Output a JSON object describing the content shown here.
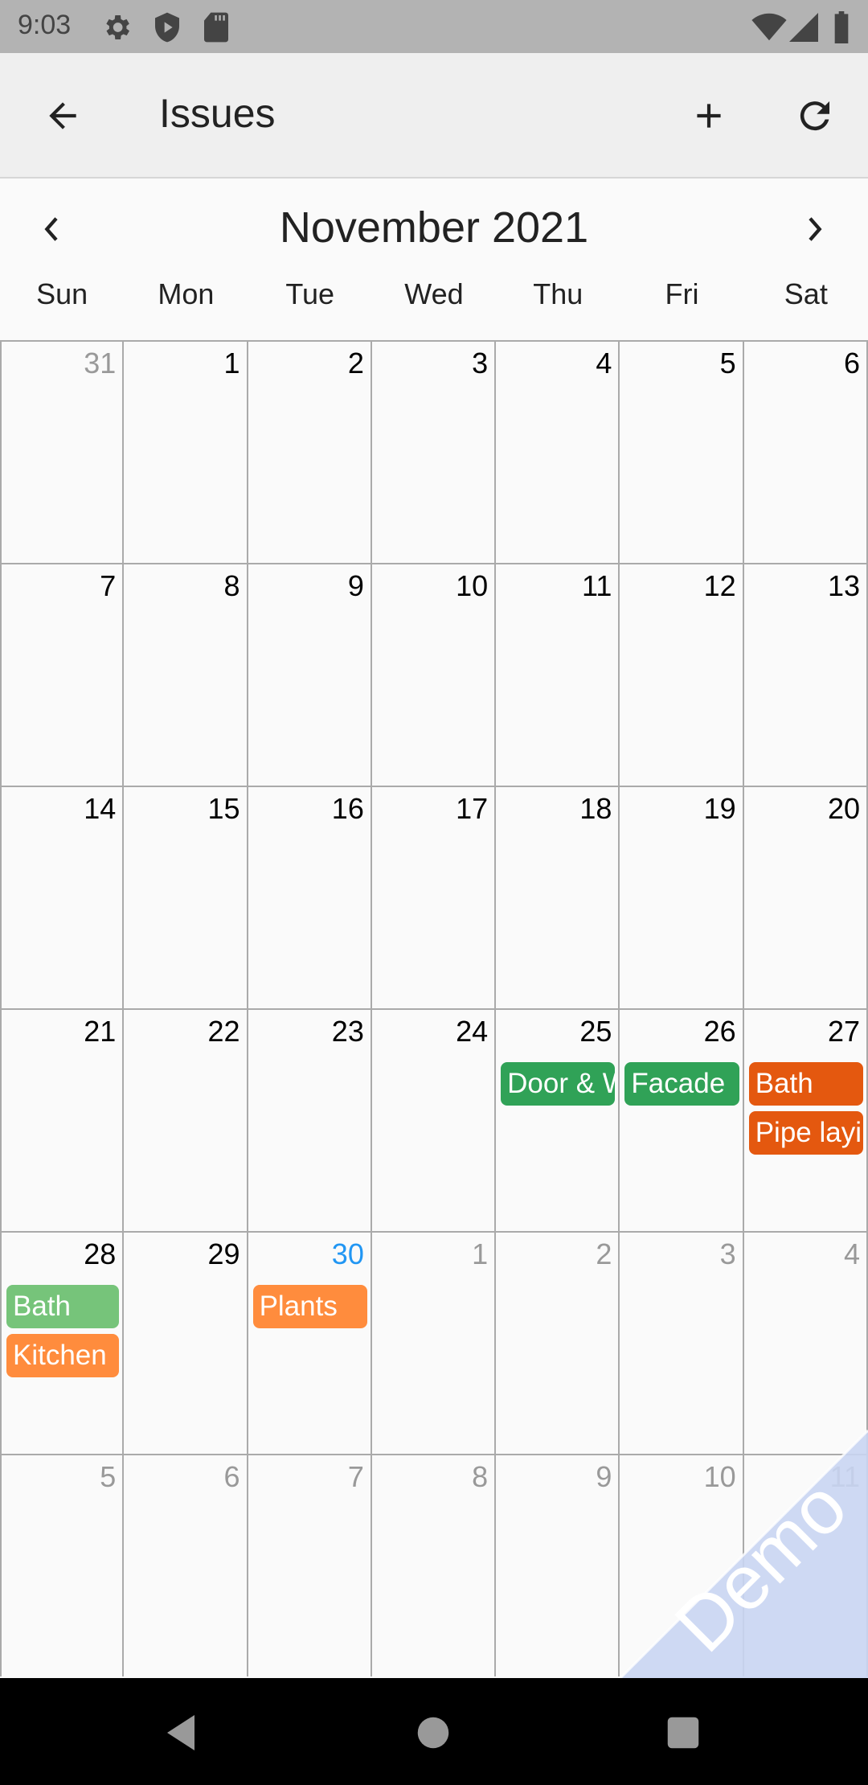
{
  "status_bar": {
    "time": "9:03",
    "left_icons": [
      "settings-icon",
      "shield-play-icon",
      "sd-card-icon"
    ],
    "right_icons": [
      "wifi-icon",
      "signal-icon",
      "battery-icon"
    ]
  },
  "app_bar": {
    "title": "Issues",
    "back_icon": "arrow-back-icon",
    "actions": [
      "add-icon",
      "refresh-icon"
    ]
  },
  "calendar": {
    "month_title": "November 2021",
    "prev_icon": "chevron-left-icon",
    "next_icon": "chevron-right-icon",
    "weekdays": [
      "Sun",
      "Mon",
      "Tue",
      "Wed",
      "Thu",
      "Fri",
      "Sat"
    ],
    "today": "30",
    "colors": {
      "today": "#2196f3",
      "other_month": "#999999"
    },
    "weeks": [
      [
        {
          "d": "31",
          "other": true
        },
        {
          "d": "1"
        },
        {
          "d": "2"
        },
        {
          "d": "3"
        },
        {
          "d": "4"
        },
        {
          "d": "5"
        },
        {
          "d": "6"
        }
      ],
      [
        {
          "d": "7"
        },
        {
          "d": "8"
        },
        {
          "d": "9"
        },
        {
          "d": "10"
        },
        {
          "d": "11"
        },
        {
          "d": "12"
        },
        {
          "d": "13"
        }
      ],
      [
        {
          "d": "14"
        },
        {
          "d": "15"
        },
        {
          "d": "16"
        },
        {
          "d": "17"
        },
        {
          "d": "18"
        },
        {
          "d": "19"
        },
        {
          "d": "20"
        }
      ],
      [
        {
          "d": "21"
        },
        {
          "d": "22"
        },
        {
          "d": "23"
        },
        {
          "d": "24"
        },
        {
          "d": "25",
          "events": [
            {
              "label": "Door & Window",
              "color": "#30a257"
            }
          ]
        },
        {
          "d": "26",
          "events": [
            {
              "label": "Facade",
              "color": "#30a257"
            }
          ]
        },
        {
          "d": "27",
          "events": [
            {
              "label": "Bath",
              "color": "#e4580f"
            },
            {
              "label": "Pipe laying",
              "color": "#e4580f"
            }
          ]
        }
      ],
      [
        {
          "d": "28",
          "events": [
            {
              "label": "Bath",
              "color": "#76c47a"
            },
            {
              "label": "Kitchen",
              "color": "#ff8c3d"
            }
          ]
        },
        {
          "d": "29"
        },
        {
          "d": "30",
          "today": true,
          "events": [
            {
              "label": "Plants",
              "color": "#ff8c3d"
            }
          ]
        },
        {
          "d": "1",
          "other": true
        },
        {
          "d": "2",
          "other": true
        },
        {
          "d": "3",
          "other": true
        },
        {
          "d": "4",
          "other": true
        }
      ],
      [
        {
          "d": "5",
          "other": true
        },
        {
          "d": "6",
          "other": true
        },
        {
          "d": "7",
          "other": true
        },
        {
          "d": "8",
          "other": true
        },
        {
          "d": "9",
          "other": true
        },
        {
          "d": "10",
          "other": true
        },
        {
          "d": "11",
          "other": true
        }
      ]
    ]
  },
  "watermark": {
    "text": "Demo",
    "color": "#c9d5f2"
  },
  "nav_bar": {
    "buttons": [
      "back-icon",
      "home-icon",
      "recents-icon"
    ]
  }
}
